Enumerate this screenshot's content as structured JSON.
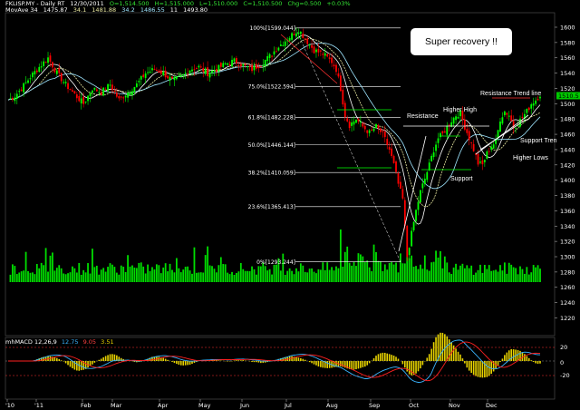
{
  "header": {
    "symbol": "FKLISP.MY - Daily RT",
    "date": "12/30/2011",
    "open": "O=1,514.500",
    "high": "H=1,515.000",
    "low": "L=1,510.000",
    "close": "C=1,510.500",
    "chg": "Chg=0.500",
    "pct": "+0.03%",
    "mov_label": "MovAve 34",
    "mov_values": [
      "1475.87",
      "34.1",
      "1481.88",
      "34.2",
      "1486.55",
      "11",
      "1493.80"
    ]
  },
  "macd_header": {
    "label": "mhMACD 12,26,9",
    "v1": "12.75",
    "v2": "9.05",
    "v3": "3.51"
  },
  "callout": "Super recovery !!",
  "colors": {
    "up": "#00ff00",
    "down": "#ff0000",
    "volume": "#00dd00",
    "ma1": "#ffffff",
    "ma2": "#e8e8a0",
    "ma3": "#9fe6ff",
    "macd_line": "#3ab4ff",
    "signal_line": "#ff2020",
    "hist": "#e6d200",
    "annotation": "#ffffff"
  },
  "chart_data": {
    "type": "candlestick",
    "ylim": [
      1190,
      1610
    ],
    "yticks": [
      "1600",
      "1580",
      "1560",
      "1540",
      "1520",
      "1500",
      "1480",
      "1460",
      "1440",
      "1420",
      "1400",
      "1380",
      "1360",
      "1340",
      "1320",
      "1300",
      "1280",
      "1260",
      "1240",
      "1220"
    ],
    "last_price_label": "1510.5",
    "xticks": [
      "'10",
      "'11",
      "Feb",
      "Mar",
      "Apr",
      "May",
      "Jun",
      "Jul",
      "Aug",
      "Sep",
      "Oct",
      "Nov",
      "Dec"
    ],
    "fib_levels": [
      {
        "label": "100%[1599.044]",
        "value": 1599.044
      },
      {
        "label": "75.0%[1522.594]",
        "value": 1522.594
      },
      {
        "label": "61.8%[1482.228]",
        "value": 1482.228
      },
      {
        "label": "50.0%[1446.144]",
        "value": 1446.144
      },
      {
        "label": "38.2%[1410.059]",
        "value": 1410.059
      },
      {
        "label": "23.6%[1365.413]",
        "value": 1365.413
      },
      {
        "label": "0%[1293.244]",
        "value": 1293.244
      }
    ],
    "annotations": [
      "Resistance",
      "Higher High",
      "Resistance Trend line",
      "Support Tren",
      "Higher Lows",
      "Support"
    ],
    "close_path": [
      [
        0,
        1505
      ],
      [
        3,
        1510
      ],
      [
        6,
        1520
      ],
      [
        10,
        1535
      ],
      [
        14,
        1548
      ],
      [
        18,
        1560
      ],
      [
        22,
        1540
      ],
      [
        26,
        1525
      ],
      [
        30,
        1512
      ],
      [
        34,
        1500
      ],
      [
        38,
        1520
      ],
      [
        42,
        1515
      ],
      [
        46,
        1525
      ],
      [
        50,
        1505
      ],
      [
        54,
        1515
      ],
      [
        58,
        1525
      ],
      [
        62,
        1540
      ],
      [
        66,
        1545
      ],
      [
        70,
        1540
      ],
      [
        74,
        1530
      ],
      [
        78,
        1535
      ],
      [
        82,
        1545
      ],
      [
        86,
        1548
      ],
      [
        90,
        1540
      ],
      [
        94,
        1545
      ],
      [
        98,
        1552
      ],
      [
        102,
        1556
      ],
      [
        106,
        1550
      ],
      [
        110,
        1545
      ],
      [
        114,
        1552
      ],
      [
        118,
        1562
      ],
      [
        122,
        1575
      ],
      [
        126,
        1585
      ],
      [
        128,
        1590
      ],
      [
        131,
        1597
      ],
      [
        134,
        1585
      ],
      [
        138,
        1570
      ],
      [
        142,
        1565
      ],
      [
        146,
        1555
      ],
      [
        148,
        1545
      ],
      [
        150,
        1520
      ],
      [
        152,
        1485
      ],
      [
        154,
        1472
      ],
      [
        157,
        1480
      ],
      [
        160,
        1470
      ],
      [
        163,
        1462
      ],
      [
        166,
        1470
      ],
      [
        169,
        1460
      ],
      [
        172,
        1440
      ],
      [
        174,
        1420
      ],
      [
        176,
        1395
      ],
      [
        178,
        1375
      ],
      [
        180,
        1300
      ],
      [
        182,
        1330
      ],
      [
        184,
        1360
      ],
      [
        186,
        1385
      ],
      [
        188,
        1402
      ],
      [
        190,
        1420
      ],
      [
        192,
        1440
      ],
      [
        194,
        1455
      ],
      [
        196,
        1460
      ],
      [
        198,
        1470
      ],
      [
        200,
        1478
      ],
      [
        202,
        1485
      ],
      [
        204,
        1488
      ],
      [
        206,
        1470
      ],
      [
        208,
        1455
      ],
      [
        210,
        1440
      ],
      [
        212,
        1422
      ],
      [
        214,
        1420
      ],
      [
        216,
        1435
      ],
      [
        218,
        1445
      ],
      [
        220,
        1450
      ],
      [
        222,
        1480
      ],
      [
        224,
        1490
      ],
      [
        226,
        1485
      ],
      [
        228,
        1470
      ],
      [
        230,
        1475
      ],
      [
        232,
        1482
      ],
      [
        234,
        1490
      ],
      [
        236,
        1500
      ],
      [
        238,
        1505
      ],
      [
        240,
        1512
      ]
    ]
  }
}
